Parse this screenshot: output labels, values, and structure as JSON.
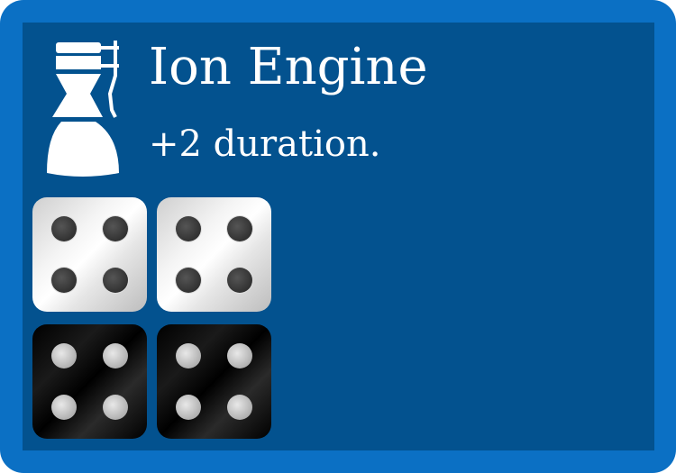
{
  "card": {
    "title": "Ion Engine",
    "description": "+2 duration.",
    "icon": "rocket-engine-icon",
    "colors": {
      "border": "#0b70c4",
      "background": "#03528f",
      "text": "#ffffff"
    }
  },
  "dice": [
    {
      "color": "white",
      "value": 4
    },
    {
      "color": "white",
      "value": 4
    },
    {
      "color": "black",
      "value": 4
    },
    {
      "color": "black",
      "value": 4
    }
  ]
}
